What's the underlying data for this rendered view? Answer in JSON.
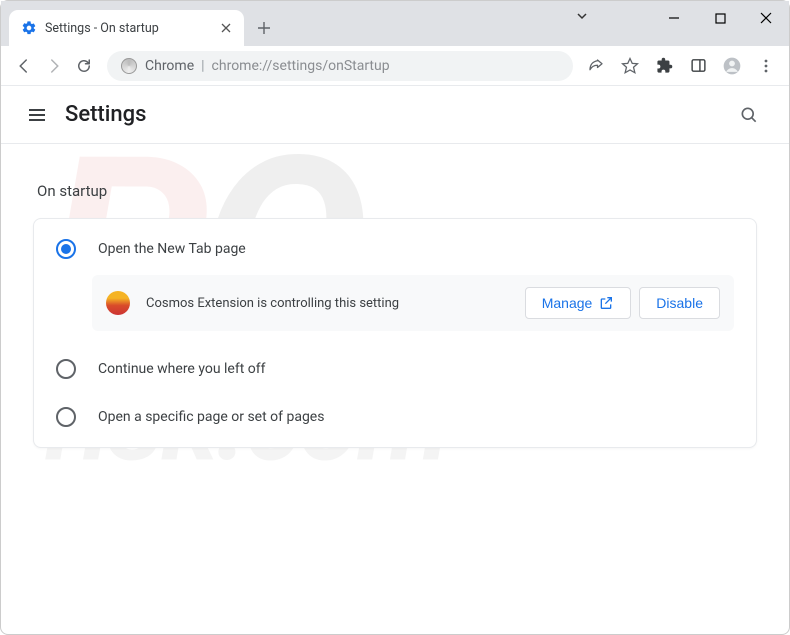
{
  "window": {
    "tab_title": "Settings - On startup"
  },
  "omnibox": {
    "protocol_label": "Chrome",
    "url_path": "chrome://settings/onStartup"
  },
  "appbar": {
    "title": "Settings"
  },
  "section": {
    "title": "On startup"
  },
  "options": {
    "new_tab": {
      "label": "Open the New Tab page",
      "selected": true
    },
    "continue": {
      "label": "Continue where you left off",
      "selected": false
    },
    "specific": {
      "label": "Open a specific page or set of pages",
      "selected": false
    }
  },
  "controller": {
    "message": "Cosmos Extension is controlling this setting",
    "manage_label": "Manage",
    "disable_label": "Disable"
  }
}
